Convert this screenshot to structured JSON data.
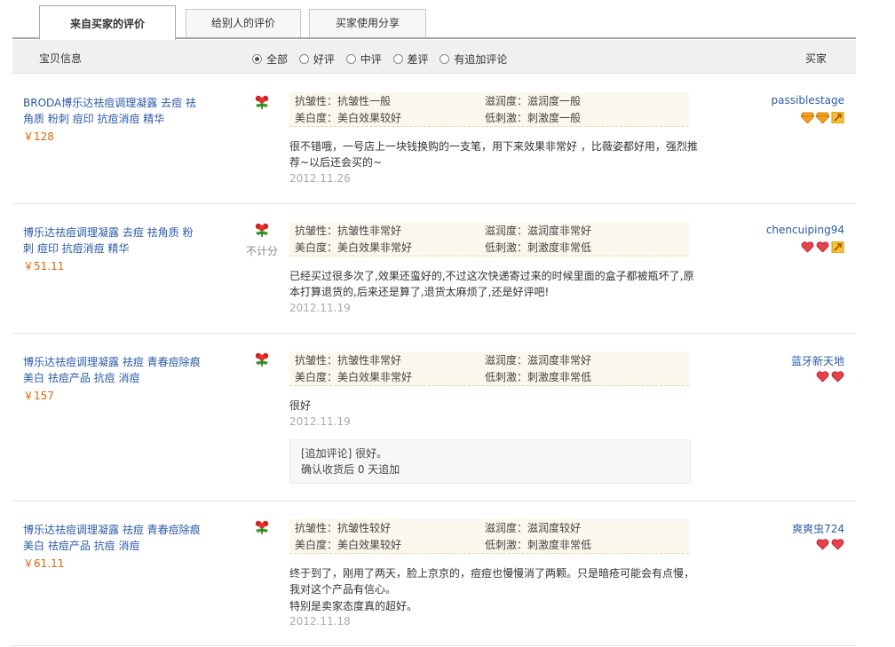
{
  "tabs": [
    "来自买家的评价",
    "给别人的评价",
    "买家使用分享"
  ],
  "header": {
    "product_col": "宝贝信息",
    "buyer_col": "买家",
    "filters": [
      "全部",
      "好评",
      "中评",
      "差评",
      "有追加评论"
    ],
    "selected_filter": "全部"
  },
  "reviews": [
    {
      "product": "BRODA博乐达祛痘调理凝露 去痘 祛角质 粉刺 痘印 抗痘消痘 精华",
      "price": "￥128",
      "rating_icon": "flower-icon",
      "attrs": [
        "抗皱性：抗皱性一般",
        "滋润度：滋润度一般",
        "美白度：美白效果较好",
        "低刺激：刺激度一般"
      ],
      "text": "很不错哦，一号店上一块钱换购的一支笔，用下来效果非常好 ，比薇姿都好用，强烈推荐~以后还会买的~",
      "date": "2012.11.26",
      "buyer": "passiblestage",
      "badges": [
        "diamond-icon",
        "diamond-icon",
        "vip-icon"
      ]
    },
    {
      "product": "博乐达祛痘调理凝露 去痘 祛角质 粉刺 痘印 抗痘消痘 精华",
      "price": "￥51.11",
      "rating_icon": "flower-icon",
      "note": "不计分",
      "attrs": [
        "抗皱性：抗皱性非常好",
        "滋润度：滋润度非常好",
        "美白度：美白效果非常好",
        "低刺激：刺激度非常低"
      ],
      "text": "已经买过很多次了,效果还蛮好的,不过这次快递寄过来的时候里面的盒子都被瓶坏了,原本打算退货的,后来还是算了,退货太麻烦了,还是好评吧!",
      "date": "2012.11.19",
      "buyer": "chencuiping94",
      "badges": [
        "heart-icon",
        "heart-icon",
        "vip-icon"
      ]
    },
    {
      "product": "博乐达祛痘调理凝露 祛痘 青春痘除痕 美白 祛痘产品 抗痘 消痘",
      "price": "￥157",
      "rating_icon": "flower-icon",
      "attrs": [
        "抗皱性：抗皱性非常好",
        "滋润度：滋润度非常好",
        "美白度：美白效果非常好",
        "低刺激：刺激度非常低"
      ],
      "text": "很好",
      "date": "2012.11.19",
      "append_text": "[追加评论] 很好。",
      "append_note": "确认收货后 0 天追加",
      "buyer": "蓝牙新天地",
      "badges": [
        "heart-icon",
        "heart-icon"
      ]
    },
    {
      "product": "博乐达祛痘调理凝露 祛痘 青春痘除痕 美白 祛痘产品 抗痘 消痘",
      "price": "￥61.11",
      "rating_icon": "flower-icon",
      "attrs": [
        "抗皱性：抗皱性较好",
        "滋润度：滋润度较好",
        "美白度：美白效果较好",
        "低刺激：刺激度非常低"
      ],
      "text": "终于到了，刚用了两天，脸上京京的，痘痘也慢慢消了两颗。只是暗疮可能会有点慢，我对这个产品有信心。",
      "text2": "特别是卖家态度真的超好。",
      "date": "2012.11.18",
      "buyer": "爽爽虫724",
      "badges": [
        "heart-icon",
        "heart-icon"
      ]
    }
  ]
}
